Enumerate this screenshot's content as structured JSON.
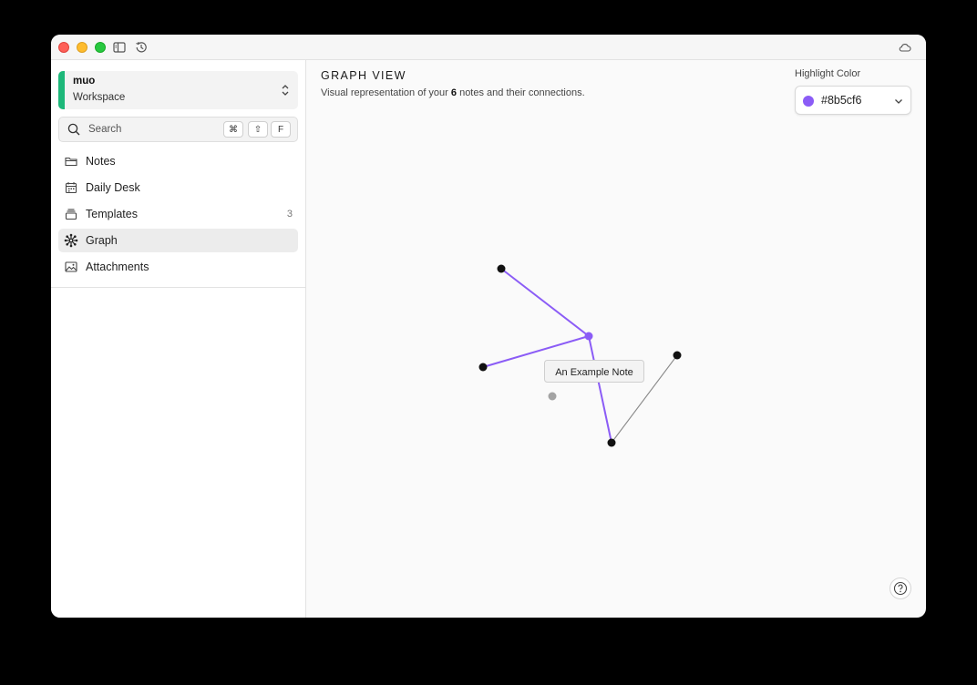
{
  "sidebar": {
    "workspace": {
      "name": "muo",
      "type": "Workspace"
    },
    "search": {
      "placeholder": "Search",
      "shortcut": [
        "⌘",
        "⇧",
        "F"
      ]
    },
    "items": [
      {
        "label": "Notes",
        "icon": "folder-icon"
      },
      {
        "label": "Daily Desk",
        "icon": "calendar-icon"
      },
      {
        "label": "Templates",
        "icon": "stack-icon",
        "count": "3"
      },
      {
        "label": "Graph",
        "icon": "graph-icon",
        "active": true
      },
      {
        "label": "Attachments",
        "icon": "image-icon"
      }
    ]
  },
  "main": {
    "title": "GRAPH VIEW",
    "subtitle_prefix": "Visual representation of your ",
    "note_count": "6",
    "subtitle_suffix": " notes and their connections.",
    "highlight": {
      "label": "Highlight Color",
      "value": "#8b5cf6"
    }
  },
  "graph": {
    "tooltip": "An Example Note",
    "highlight_color": "#8b5cf6",
    "node_color": "#111111",
    "orphan_color": "#a3a3a3",
    "edge_color": "#8a8a8a"
  },
  "colors": {
    "workspace_accent": "#1db87a",
    "active_nav_bg": "#ececec"
  }
}
